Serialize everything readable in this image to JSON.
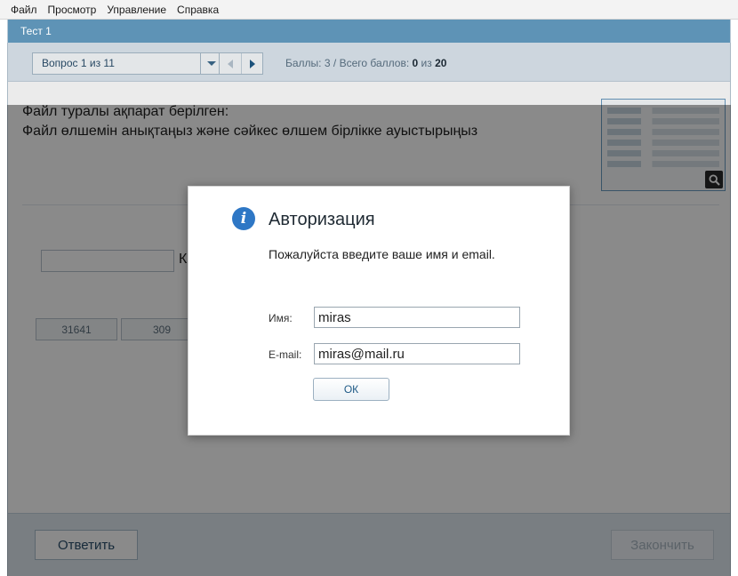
{
  "menu": {
    "items": [
      "Файл",
      "Просмотр",
      "Управление",
      "Справка"
    ]
  },
  "window": {
    "title": "Тест 1"
  },
  "toolbar": {
    "question_selector": "Вопрос 1 из 11",
    "score_label": "Баллы: 3",
    "separator": "/",
    "total_label": "Всего баллов:",
    "total_current": "0",
    "total_of": "из",
    "total_max": "20"
  },
  "question": {
    "line1": "Файл туралы ақпарат берілген:",
    "line2": "Файл өлшемін анықтаңыз және сәйкес өлшем бірлікке ауыстырыңыз"
  },
  "answer": {
    "unit_prefix": "К",
    "options": [
      "31641",
      "309"
    ]
  },
  "bottom": {
    "answer_button": "Ответить",
    "finish_button": "Закончить"
  },
  "modal": {
    "title": "Авторизация",
    "text": "Пожалуйста введите ваше имя и email.",
    "name_label": "Имя:",
    "name_value": "miras",
    "email_label": "E-mail:",
    "email_value": "miras@mail.ru",
    "ok_label": "ОК"
  },
  "colors": {
    "titlebar": "#5e93b6",
    "toolbar": "#dfe9f1",
    "info_icon": "#2e77c5"
  },
  "icons": {
    "question_dropdown": "chevron-down-icon",
    "prev": "triangle-left-icon",
    "next": "triangle-right-icon",
    "zoom": "magnifier-icon",
    "info": "info-icon"
  }
}
